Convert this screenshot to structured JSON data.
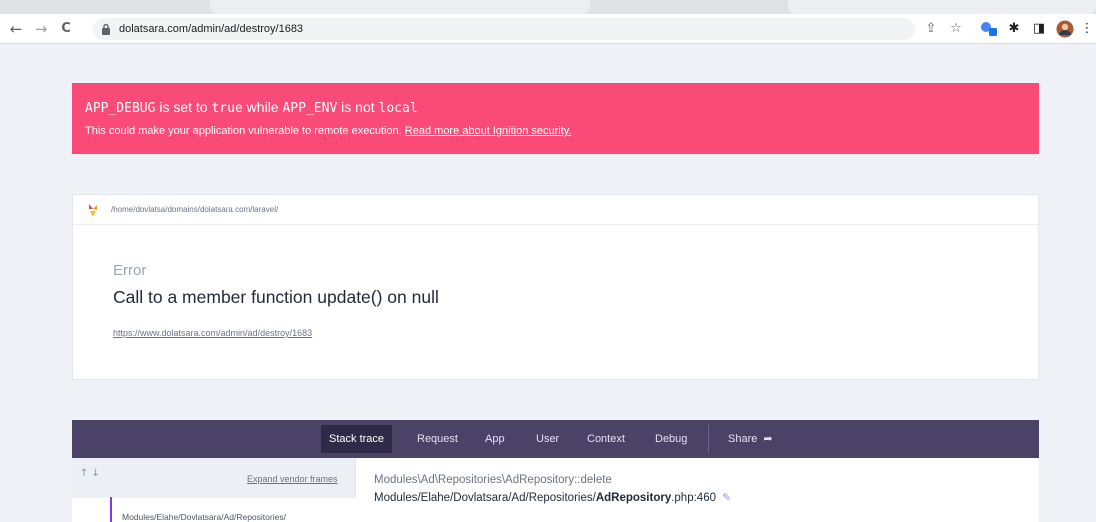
{
  "browser": {
    "url": "dolatsara.com/admin/ad/destroy/1683",
    "back_glyph": "←",
    "forward_glyph": "→",
    "reload_glyph": "C",
    "share_glyph": "⇪",
    "star_glyph": "☆",
    "puzzle_glyph": "✱",
    "sidepanel_glyph": "◨",
    "menu_glyph": "⋮"
  },
  "warning": {
    "p1": "APP_DEBUG",
    "p2": " is set to ",
    "p3": "true",
    "p4": " while ",
    "p5": "APP_ENV",
    "p6": " is not ",
    "p7": "local",
    "text": "This could make your application vulnerable to remote execution.",
    "link": "Read more about Ignition security."
  },
  "error": {
    "path": "/home/dovlatsa/domains/dolatsara.com/laravel/",
    "class": "Error",
    "message": "Call to a member function update() on null",
    "url": "https://www.dolatsara.com/admin/ad/destroy/1683"
  },
  "tabs": {
    "stack_trace": "Stack trace",
    "request": "Request",
    "app": "App",
    "user": "User",
    "context": "Context",
    "debug": "Debug",
    "share": "Share",
    "share_glyph": "➦"
  },
  "stack": {
    "arrows": "↑ ↓",
    "expand": "Expand vendor frames",
    "frame_text": "Modules/Elahe/Dovlatsara/Ad/Repositories/",
    "method_ns": "Modules\\Ad\\Repositories\\",
    "method_class": "AdRepository",
    "method_fn": "::delete",
    "file_dir": "Modules/Elahe/Dovlatsara/Ad/Repositories/",
    "file_name": "AdRepository",
    "file_ext": ".php:460",
    "pencil_glyph": "✎"
  },
  "colors": {
    "warning_bg": "#f94a78",
    "tabs_bg": "#4a4365",
    "active_tab_bg": "#2f2a47",
    "accent": "#7c3aed"
  }
}
